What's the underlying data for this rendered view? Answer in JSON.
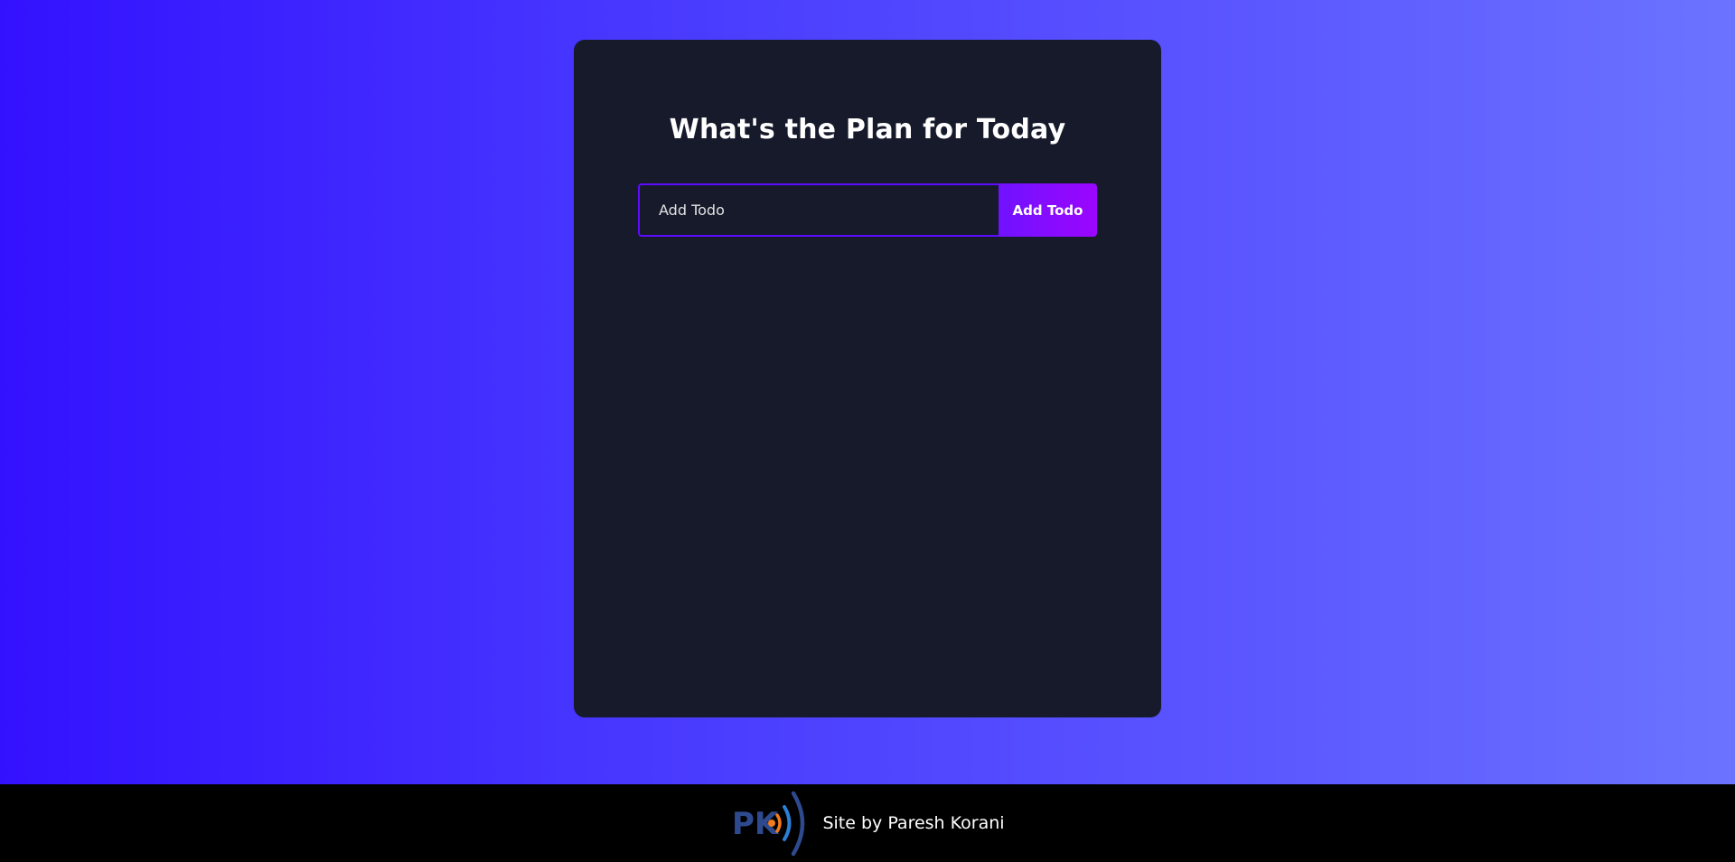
{
  "app": {
    "heading": "What's the Plan for Today"
  },
  "todo_form": {
    "input_placeholder": "Add Todo",
    "input_value": "",
    "submit_label": "Add Todo"
  },
  "todo_list": {
    "items": []
  },
  "footer": {
    "logo_text": "PK",
    "logo_icon": "broadcast-signal-icon",
    "credit_text": "Site by Paresh Korani"
  },
  "colors": {
    "background_gradient_start": "#3311ff",
    "background_gradient_end": "#6b73ff",
    "card_background": "#161a2b",
    "accent_purple": "#5d0cff",
    "button_gradient_end": "#9b06ff",
    "footer_background": "#000000",
    "logo_letters": "#2e4a8f",
    "logo_dot": "#f07c1c",
    "logo_waves": "#2a7fd6"
  }
}
